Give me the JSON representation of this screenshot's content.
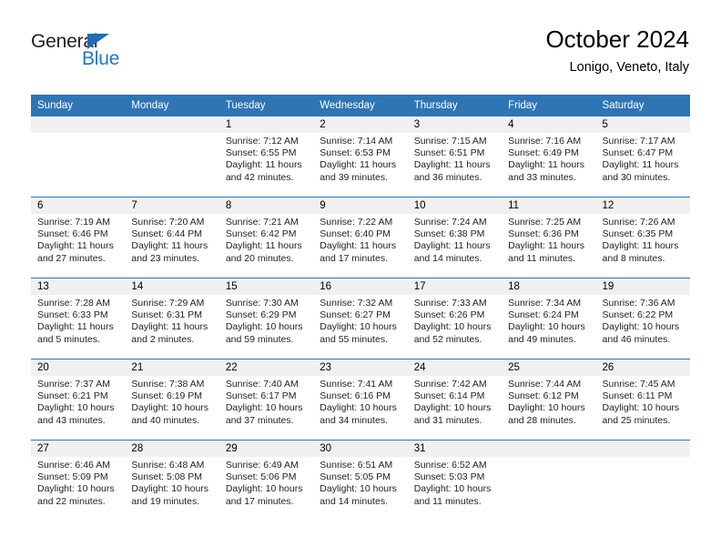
{
  "logo": {
    "word_top": "General",
    "word_bottom": "Blue",
    "triangle_color": "#1f6db4",
    "blue_color": "#1f77c0"
  },
  "header": {
    "title": "October 2024",
    "subtitle": "Lonigo, Veneto, Italy"
  },
  "theme": {
    "header_blue": "#2e75b6",
    "daynum_band": "#f0f0f0",
    "text": "#222222"
  },
  "labels": {
    "sunrise_prefix": "Sunrise:",
    "sunset_prefix": "Sunset:",
    "daylight_prefix": "Daylight:"
  },
  "day_headers": [
    "Sunday",
    "Monday",
    "Tuesday",
    "Wednesday",
    "Thursday",
    "Friday",
    "Saturday"
  ],
  "weeks": [
    [
      {
        "day": "",
        "sunrise": "",
        "sunset": "",
        "daylight": "",
        "empty": true
      },
      {
        "day": "",
        "sunrise": "",
        "sunset": "",
        "daylight": "",
        "empty": true
      },
      {
        "day": "1",
        "sunrise": "Sunrise: 7:12 AM",
        "sunset": "Sunset: 6:55 PM",
        "daylight": "Daylight: 11 hours and 42 minutes."
      },
      {
        "day": "2",
        "sunrise": "Sunrise: 7:14 AM",
        "sunset": "Sunset: 6:53 PM",
        "daylight": "Daylight: 11 hours and 39 minutes."
      },
      {
        "day": "3",
        "sunrise": "Sunrise: 7:15 AM",
        "sunset": "Sunset: 6:51 PM",
        "daylight": "Daylight: 11 hours and 36 minutes."
      },
      {
        "day": "4",
        "sunrise": "Sunrise: 7:16 AM",
        "sunset": "Sunset: 6:49 PM",
        "daylight": "Daylight: 11 hours and 33 minutes."
      },
      {
        "day": "5",
        "sunrise": "Sunrise: 7:17 AM",
        "sunset": "Sunset: 6:47 PM",
        "daylight": "Daylight: 11 hours and 30 minutes."
      }
    ],
    [
      {
        "day": "6",
        "sunrise": "Sunrise: 7:19 AM",
        "sunset": "Sunset: 6:46 PM",
        "daylight": "Daylight: 11 hours and 27 minutes."
      },
      {
        "day": "7",
        "sunrise": "Sunrise: 7:20 AM",
        "sunset": "Sunset: 6:44 PM",
        "daylight": "Daylight: 11 hours and 23 minutes."
      },
      {
        "day": "8",
        "sunrise": "Sunrise: 7:21 AM",
        "sunset": "Sunset: 6:42 PM",
        "daylight": "Daylight: 11 hours and 20 minutes."
      },
      {
        "day": "9",
        "sunrise": "Sunrise: 7:22 AM",
        "sunset": "Sunset: 6:40 PM",
        "daylight": "Daylight: 11 hours and 17 minutes."
      },
      {
        "day": "10",
        "sunrise": "Sunrise: 7:24 AM",
        "sunset": "Sunset: 6:38 PM",
        "daylight": "Daylight: 11 hours and 14 minutes."
      },
      {
        "day": "11",
        "sunrise": "Sunrise: 7:25 AM",
        "sunset": "Sunset: 6:36 PM",
        "daylight": "Daylight: 11 hours and 11 minutes."
      },
      {
        "day": "12",
        "sunrise": "Sunrise: 7:26 AM",
        "sunset": "Sunset: 6:35 PM",
        "daylight": "Daylight: 11 hours and 8 minutes."
      }
    ],
    [
      {
        "day": "13",
        "sunrise": "Sunrise: 7:28 AM",
        "sunset": "Sunset: 6:33 PM",
        "daylight": "Daylight: 11 hours and 5 minutes."
      },
      {
        "day": "14",
        "sunrise": "Sunrise: 7:29 AM",
        "sunset": "Sunset: 6:31 PM",
        "daylight": "Daylight: 11 hours and 2 minutes."
      },
      {
        "day": "15",
        "sunrise": "Sunrise: 7:30 AM",
        "sunset": "Sunset: 6:29 PM",
        "daylight": "Daylight: 10 hours and 59 minutes."
      },
      {
        "day": "16",
        "sunrise": "Sunrise: 7:32 AM",
        "sunset": "Sunset: 6:27 PM",
        "daylight": "Daylight: 10 hours and 55 minutes."
      },
      {
        "day": "17",
        "sunrise": "Sunrise: 7:33 AM",
        "sunset": "Sunset: 6:26 PM",
        "daylight": "Daylight: 10 hours and 52 minutes."
      },
      {
        "day": "18",
        "sunrise": "Sunrise: 7:34 AM",
        "sunset": "Sunset: 6:24 PM",
        "daylight": "Daylight: 10 hours and 49 minutes."
      },
      {
        "day": "19",
        "sunrise": "Sunrise: 7:36 AM",
        "sunset": "Sunset: 6:22 PM",
        "daylight": "Daylight: 10 hours and 46 minutes."
      }
    ],
    [
      {
        "day": "20",
        "sunrise": "Sunrise: 7:37 AM",
        "sunset": "Sunset: 6:21 PM",
        "daylight": "Daylight: 10 hours and 43 minutes."
      },
      {
        "day": "21",
        "sunrise": "Sunrise: 7:38 AM",
        "sunset": "Sunset: 6:19 PM",
        "daylight": "Daylight: 10 hours and 40 minutes."
      },
      {
        "day": "22",
        "sunrise": "Sunrise: 7:40 AM",
        "sunset": "Sunset: 6:17 PM",
        "daylight": "Daylight: 10 hours and 37 minutes."
      },
      {
        "day": "23",
        "sunrise": "Sunrise: 7:41 AM",
        "sunset": "Sunset: 6:16 PM",
        "daylight": "Daylight: 10 hours and 34 minutes."
      },
      {
        "day": "24",
        "sunrise": "Sunrise: 7:42 AM",
        "sunset": "Sunset: 6:14 PM",
        "daylight": "Daylight: 10 hours and 31 minutes."
      },
      {
        "day": "25",
        "sunrise": "Sunrise: 7:44 AM",
        "sunset": "Sunset: 6:12 PM",
        "daylight": "Daylight: 10 hours and 28 minutes."
      },
      {
        "day": "26",
        "sunrise": "Sunrise: 7:45 AM",
        "sunset": "Sunset: 6:11 PM",
        "daylight": "Daylight: 10 hours and 25 minutes."
      }
    ],
    [
      {
        "day": "27",
        "sunrise": "Sunrise: 6:46 AM",
        "sunset": "Sunset: 5:09 PM",
        "daylight": "Daylight: 10 hours and 22 minutes."
      },
      {
        "day": "28",
        "sunrise": "Sunrise: 6:48 AM",
        "sunset": "Sunset: 5:08 PM",
        "daylight": "Daylight: 10 hours and 19 minutes."
      },
      {
        "day": "29",
        "sunrise": "Sunrise: 6:49 AM",
        "sunset": "Sunset: 5:06 PM",
        "daylight": "Daylight: 10 hours and 17 minutes."
      },
      {
        "day": "30",
        "sunrise": "Sunrise: 6:51 AM",
        "sunset": "Sunset: 5:05 PM",
        "daylight": "Daylight: 10 hours and 14 minutes."
      },
      {
        "day": "31",
        "sunrise": "Sunrise: 6:52 AM",
        "sunset": "Sunset: 5:03 PM",
        "daylight": "Daylight: 10 hours and 11 minutes."
      },
      {
        "day": "",
        "sunrise": "",
        "sunset": "",
        "daylight": "",
        "empty": true
      },
      {
        "day": "",
        "sunrise": "",
        "sunset": "",
        "daylight": "",
        "empty": true
      }
    ]
  ]
}
